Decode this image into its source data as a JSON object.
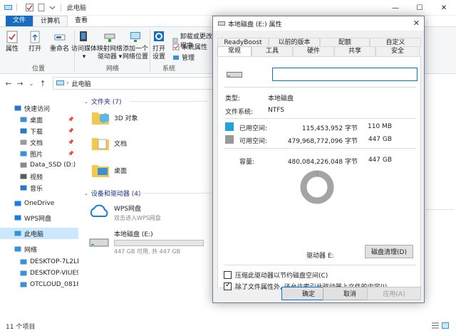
{
  "explorer": {
    "title": "此电脑",
    "ribbon_tabs": [
      "文件",
      "计算机",
      "查看"
    ],
    "ribbon": {
      "groups": [
        "位置",
        "网络",
        "系统"
      ],
      "location_buttons": [
        "属性",
        "打开",
        "重命名"
      ],
      "network_buttons": [
        {
          "label": "访问媒体",
          "sub": "▾"
        },
        {
          "label": "映射网络",
          "sub": "驱动器 ▾"
        },
        {
          "label": "添加一个",
          "sub": "网络位置"
        }
      ],
      "system_open": {
        "label": "打开",
        "sub": "设置"
      },
      "system_small": [
        "卸载或更改程序",
        "系统属性",
        "管理"
      ]
    },
    "address": "此电脑",
    "sidebar": {
      "items": [
        {
          "label": "快速访问",
          "icon": "star-icon"
        },
        {
          "label": "桌面",
          "icon": "desktop-icon",
          "pinned": true
        },
        {
          "label": "下载",
          "icon": "download-icon",
          "pinned": true
        },
        {
          "label": "文档",
          "icon": "document-icon",
          "pinned": true
        },
        {
          "label": "图片",
          "icon": "picture-icon",
          "pinned": true
        },
        {
          "label": "Data_SSD (D:)",
          "icon": "drive-icon"
        },
        {
          "label": "视频",
          "icon": "video-icon"
        },
        {
          "label": "音乐",
          "icon": "music-icon"
        },
        {
          "label": "OneDrive",
          "icon": "cloud-icon"
        },
        {
          "label": "WPS网盘",
          "icon": "wps-cloud-icon"
        },
        {
          "label": "此电脑",
          "icon": "computer-icon",
          "selected": true
        },
        {
          "label": "网络",
          "icon": "network-icon"
        },
        {
          "label": "DESKTOP-7L2LBGJ",
          "icon": "computer-icon"
        },
        {
          "label": "DESKTOP-VIUE9A4",
          "icon": "computer-icon"
        },
        {
          "label": "OTCLOUD_0818",
          "icon": "computer-icon"
        }
      ]
    },
    "folders_header": "文件夹 (7)",
    "folders": [
      "3D 对象",
      "文档",
      "桌面"
    ],
    "devices_header": "设备和驱动器 (4)",
    "devices": [
      {
        "name": "WPS网盘",
        "sub": "双击进入WPS网盘"
      },
      {
        "name": "本地磁盘 (E:)",
        "sub": "447 GB 可用, 共 447 GB",
        "used_fraction": 0.0
      }
    ],
    "status": "11 个项目"
  },
  "dialog": {
    "title": "本地磁盘 (E:) 属性",
    "tabs_row1": [
      "ReadyBoost",
      "以前的版本",
      "配额",
      "自定义"
    ],
    "tabs_row2": [
      "常规",
      "工具",
      "硬件",
      "共享",
      "安全"
    ],
    "active_tab": "常规",
    "name_value": "",
    "type_label": "类型:",
    "type_value": "本地磁盘",
    "fs_label": "文件系统:",
    "fs_value": "NTFS",
    "used": {
      "label": "已用空间:",
      "bytes": "115,453,952 字节",
      "size": "110 MB",
      "color": "#26a0da"
    },
    "free": {
      "label": "可用空间:",
      "bytes": "479,968,772,096 字节",
      "size": "447 GB",
      "color": "#999999"
    },
    "capacity": {
      "label": "容量:",
      "bytes": "480,084,226,048 字节",
      "size": "447 GB"
    },
    "used_fraction": 0.0002,
    "drive_label": "驱动器 E:",
    "cleanup_button": "磁盘清理(D)",
    "compress_option": "压缩此驱动器以节约磁盘空间(C)",
    "compress_checked": false,
    "index_option": "除了文件属性外, 还允许索引此驱动器上文件的内容(I)",
    "index_checked": true,
    "ok": "确定",
    "cancel": "取消",
    "apply": "应用(A)"
  }
}
